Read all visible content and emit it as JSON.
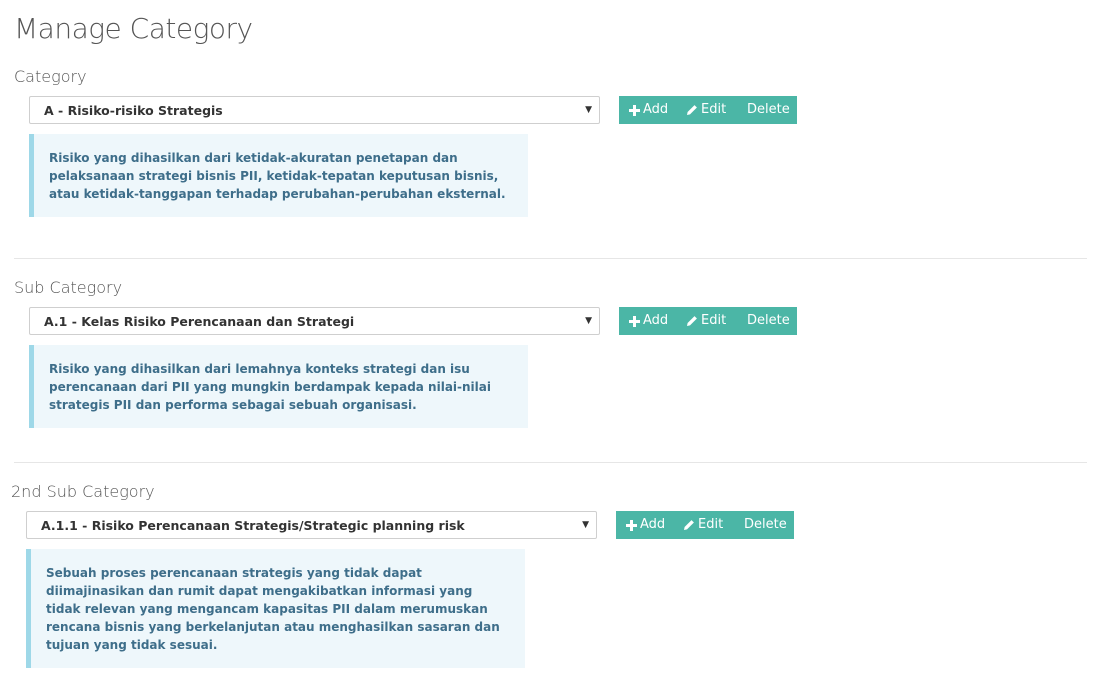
{
  "page": {
    "title": "Manage Category"
  },
  "sections": [
    {
      "label": "Category",
      "selected": "A - Risiko-risiko Strategis",
      "description": "Risiko yang dihasilkan dari ketidak-akuratan penetapan dan pelaksanaan strategi bisnis PII, ketidak-tepatan keputusan bisnis, atau ketidak-tanggapan terhadap perubahan-perubahan eksternal."
    },
    {
      "label": "Sub Category",
      "selected": "A.1 - Kelas Risiko Perencanaan dan Strategi",
      "description": "Risiko yang dihasilkan dari lemahnya konteks strategi dan isu perencanaan dari PII yang mungkin berdampak kepada nilai-nilai strategis PII dan performa sebagai sebuah organisasi."
    },
    {
      "label": "2nd Sub Category",
      "selected": "A.1.1 - Risiko Perencanaan Strategis/Strategic planning risk",
      "description": "Sebuah proses perencanaan strategis yang tidak dapat diimajinasikan dan rumit dapat mengakibatkan informasi yang tidak relevan yang mengancam kapasitas PII dalam merumuskan rencana bisnis yang berkelanjutan atau menghasilkan sasaran dan tujuan yang tidak sesuai."
    }
  ],
  "actions": {
    "add_label": "Add",
    "edit_label": "Edit",
    "delete_label": "Delete"
  },
  "icons": {
    "add": "plus-icon",
    "edit": "pencil-icon",
    "select": "caret-down-icon"
  },
  "colors": {
    "button_bg": "#4bb6a6",
    "info_bg": "#eef7fb",
    "info_border": "#9ed8e8",
    "info_text": "#3e6e8a"
  }
}
